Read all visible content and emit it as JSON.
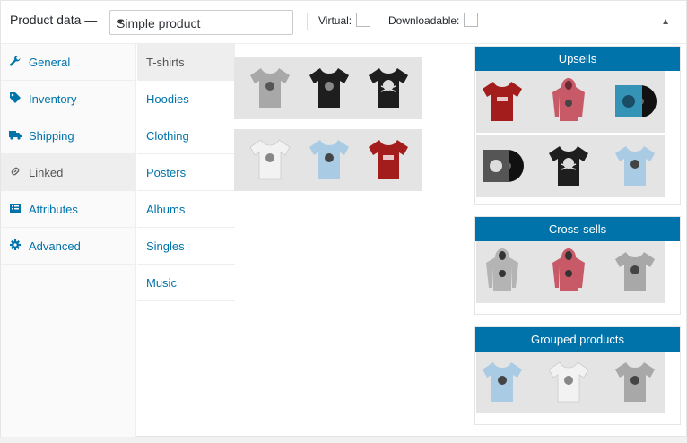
{
  "header": {
    "title": "Product data —",
    "product_type": "Simple product",
    "virtual_label": "Virtual:",
    "downloadable_label": "Downloadable:"
  },
  "tabs": [
    {
      "label": "General",
      "icon": "wrench-icon"
    },
    {
      "label": "Inventory",
      "icon": "tag-icon"
    },
    {
      "label": "Shipping",
      "icon": "truck-icon"
    },
    {
      "label": "Linked",
      "icon": "link-icon",
      "active": true
    },
    {
      "label": "Attributes",
      "icon": "list-icon"
    },
    {
      "label": "Advanced",
      "icon": "gear-icon"
    }
  ],
  "categories": [
    {
      "label": "T-shirts",
      "active": true
    },
    {
      "label": "Hoodies"
    },
    {
      "label": "Clothing"
    },
    {
      "label": "Posters"
    },
    {
      "label": "Albums"
    },
    {
      "label": "Singles"
    },
    {
      "label": "Music"
    }
  ],
  "boxes": {
    "upsells": "Upsells",
    "cross_sells": "Cross-sells",
    "grouped": "Grouped products"
  },
  "colors": {
    "accent": "#0073aa",
    "tile_bg": "#e4e4e4",
    "grey_shirt": "#a8a8a8",
    "black_shirt": "#1e1e1e",
    "white_shirt": "#f2f2f2",
    "blue_shirt": "#a9cbe4",
    "red_shirt": "#a31d1d",
    "pink_hoodie": "#c85a67"
  }
}
